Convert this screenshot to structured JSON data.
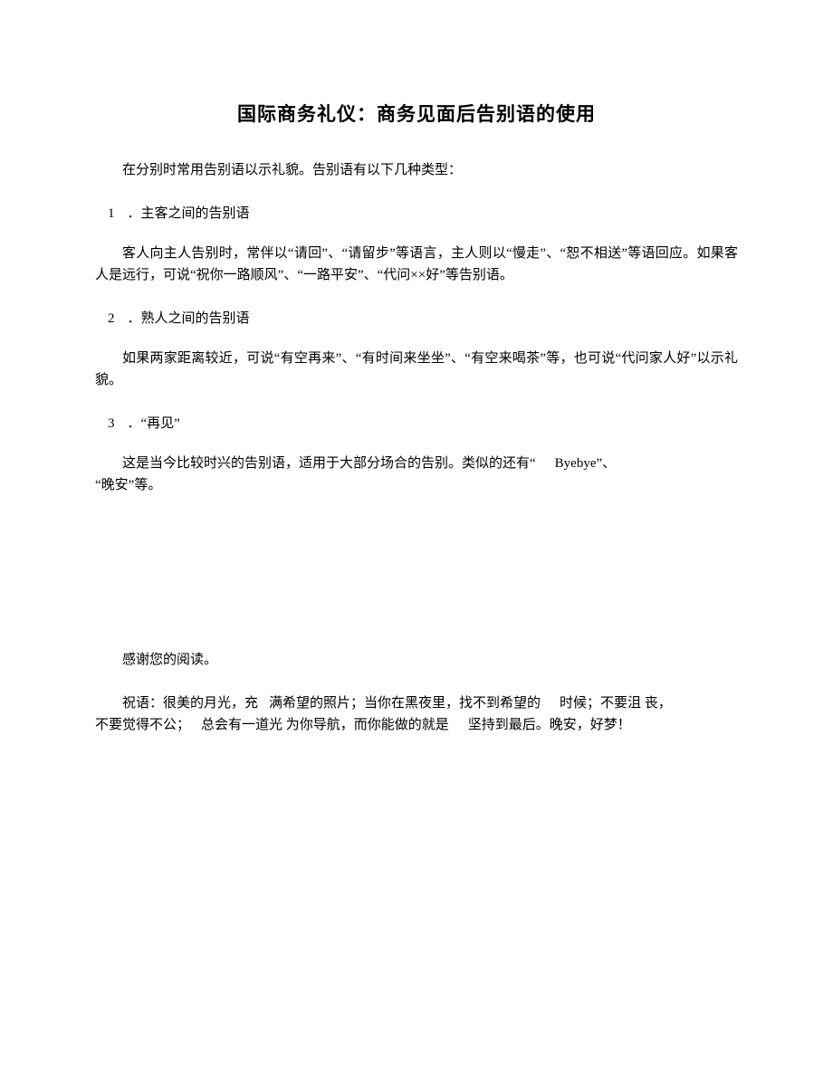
{
  "title": "国际商务礼仪：商务见面后告别语的使用",
  "intro": "在分别时常用告别语以示礼貌。告别语有以下几种类型：",
  "sections": [
    {
      "num": "1",
      "dot": "．",
      "heading": "主客之间的告别语",
      "body": "客人向主人告别时，常伴以“请回”、“请留步”等语言，主人则以“慢走”、“恕不相送”等语回应。如果客人是远行，可说“祝你一路顺风”、“一路平安”、“代问××好”等告别语。"
    },
    {
      "num": "2",
      "dot": "．",
      "heading": "熟人之间的告别语",
      "body": "如果两家距离较近，可说“有空再来”、“有时间来坐坐”、“有空来喝茶”等，也可说“代问家人好”以示礼貌。"
    },
    {
      "num": "3",
      "dot": "．",
      "heading": "“再见”",
      "body_part1": "这是当今比较时兴的告别语，适用于大部分场合的告别。类似的还有“",
      "body_part2": "Byebye”、",
      "body_part3": "“晚安”等。"
    }
  ],
  "thanks": "感谢您的阅读。",
  "blessing": {
    "p1": "祝语：很美的月光，充",
    "p2": "满希望的照片；当你在黑夜里，找不到希望的",
    "p3": "时候；不要沮 丧，",
    "p4": "不要觉得不公；",
    "p5": "总会有一道光 为你导航，而你能做的就是",
    "p6": "坚持到最后。晚安，好梦！"
  }
}
